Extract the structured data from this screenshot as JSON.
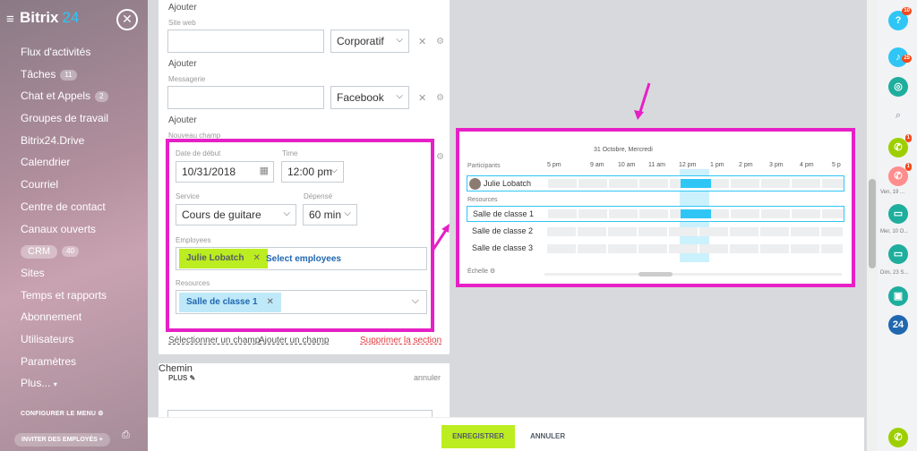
{
  "sidebar": {
    "logo_text": "Bitrix",
    "logo_num": "24",
    "items": [
      {
        "label": "Flux d'activités",
        "count": ""
      },
      {
        "label": "Tâches",
        "count": "11"
      },
      {
        "label": "Chat et Appels",
        "count": "2"
      },
      {
        "label": "Groupes de travail",
        "count": ""
      },
      {
        "label": "Bitrix24.Drive",
        "count": ""
      },
      {
        "label": "Calendrier",
        "count": ""
      },
      {
        "label": "Courriel",
        "count": ""
      },
      {
        "label": "Centre de contact",
        "count": ""
      },
      {
        "label": "Canaux ouverts",
        "count": ""
      },
      {
        "label": "CRM",
        "count": "40"
      },
      {
        "label": "Sites",
        "count": ""
      },
      {
        "label": "Temps et rapports",
        "count": ""
      },
      {
        "label": "Abonnement",
        "count": ""
      },
      {
        "label": "Utilisateurs",
        "count": ""
      },
      {
        "label": "Paramètres",
        "count": ""
      },
      {
        "label": "Plus...",
        "count": ""
      }
    ],
    "configure": "CONFIGURER LE MENU",
    "invite": "INVITER DES EMPLOYÉS"
  },
  "form": {
    "ajouter1": "Ajouter",
    "siteweb_label": "Site web",
    "siteweb_value": "",
    "siteweb_type": "Corporatif",
    "ajouter2": "Ajouter",
    "messagerie_label": "Messagerie",
    "messagerie_value": "",
    "messagerie_type": "Facebook",
    "ajouter3": "Ajouter",
    "nouveau_champ": "Nouveau champ",
    "date_label": "Date de début",
    "date_value": "10/31/2018",
    "time_label": "Time",
    "time_value": "12:00 pm",
    "service_label": "Service",
    "service_value": "Cours de guitare",
    "depense_label": "Dépensé",
    "depense_value": "60 min",
    "employees_label": "Employees",
    "employee_tag": "Julie Lobatch",
    "select_employees": "Select employees",
    "resources_label": "Resources",
    "resource_tag": "Salle de classe 1",
    "select_field": "Sélectionner un champ",
    "add_field": "Ajouter un champ",
    "delete_section": "Supprimer la section",
    "plus_title": "PLUS",
    "plus_cancel": "annuler",
    "chemin_label": "Chemin"
  },
  "calendar": {
    "date_header": "31 Octobre, Mercredi",
    "participants_label": "Participants",
    "resources_label": "Resources",
    "times": [
      "5 pm",
      "9 am",
      "10 am",
      "11 am",
      "12 pm",
      "1 pm",
      "2 pm",
      "3 pm",
      "4 pm",
      "5 p"
    ],
    "participants": [
      "Julie Lobatch"
    ],
    "resources": [
      "Salle de classe 1",
      "Salle de classe 2",
      "Salle de classe 3"
    ],
    "scale_label": "Échelle"
  },
  "footer": {
    "save": "ENREGISTRER",
    "cancel": "ANNULER"
  },
  "rightbar": {
    "badge_help": "10",
    "badge_notif": "25",
    "badge_call1": "1",
    "badge_call2": "1",
    "t1": "Ven, 19 ...",
    "t2": "Mer, 10 O...",
    "t3": "Dim, 23 S..."
  },
  "colors": {
    "highlight": "#e620c6",
    "accent": "#2fc6f6",
    "save_button": "#bbed21",
    "employee_tag": "#bbed21",
    "resource_tag": "#bfe9f8"
  }
}
